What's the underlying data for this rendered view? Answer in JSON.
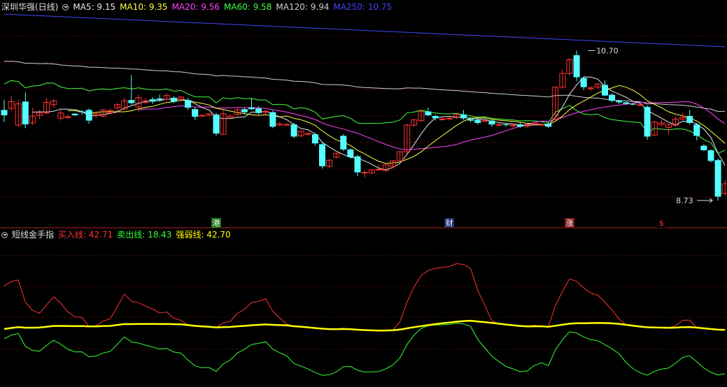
{
  "main_header": {
    "title": "深圳华强(日线)",
    "ma_labels": [
      {
        "text": "MA5: 9.15",
        "color": "#e8e8e8"
      },
      {
        "text": "MA10: 9.35",
        "color": "#ffff44"
      },
      {
        "text": "MA20: 9.56",
        "color": "#ff44ff"
      },
      {
        "text": "MA60: 9.58",
        "color": "#44ff44"
      },
      {
        "text": "MA120: 9.94",
        "color": "#d0d0d0"
      },
      {
        "text": "MA250: 10.75",
        "color": "#4444ff"
      }
    ]
  },
  "sub_header": {
    "title": "短线金手指",
    "labels": [
      {
        "text": "买入线: 42.71",
        "color": "#ff3333"
      },
      {
        "text": "卖出线: 18.43",
        "color": "#33ff33"
      },
      {
        "text": "强弱线: 42.70",
        "color": "#ffff00"
      }
    ]
  },
  "markers": [
    {
      "text": "港",
      "bg": "#1a7a1a",
      "fg": "#ffffff",
      "index": 30
    },
    {
      "text": "财",
      "bg": "#1a2a6a",
      "fg": "#ffffff",
      "index": 63
    },
    {
      "text": "涨",
      "bg": "#7a1a1a",
      "fg": "#ffffff",
      "index": 80
    },
    {
      "text": "$",
      "bg": "#000000",
      "fg": "#ff3333",
      "index": 93
    }
  ],
  "colors": {
    "up": "#ff3333",
    "down": "#54ffff",
    "grid": "#8b1a1a"
  },
  "chart_data": [
    {
      "type": "candlestick",
      "title": "深圳华强(日线)",
      "ylim": [
        8.5,
        11.2
      ],
      "annotations": [
        {
          "text": "10.70",
          "index": 82,
          "price": 10.7
        },
        {
          "text": "8.73",
          "index": 101,
          "price": 8.73
        }
      ],
      "candles": [
        [
          9.92,
          9.85,
          10.05,
          9.76
        ],
        [
          9.94,
          10.03,
          10.1,
          9.9
        ],
        [
          9.72,
          10.0,
          10.05,
          9.7
        ],
        [
          10.03,
          9.73,
          10.15,
          9.68
        ],
        [
          9.75,
          9.84,
          9.95,
          9.72
        ],
        [
          9.85,
          9.88,
          9.92,
          9.8
        ],
        [
          9.88,
          10.02,
          10.08,
          9.86
        ],
        [
          9.99,
          10.04,
          10.06,
          9.95
        ],
        [
          9.81,
          9.88,
          9.92,
          9.78
        ],
        [
          9.82,
          9.83,
          9.86,
          9.8
        ],
        [
          9.87,
          9.85,
          9.88,
          9.84
        ],
        [
          9.9,
          9.89,
          9.92,
          9.86
        ],
        [
          9.92,
          9.78,
          9.94,
          9.74
        ],
        [
          9.85,
          9.87,
          9.89,
          9.82
        ],
        [
          9.84,
          9.92,
          9.93,
          9.82
        ],
        [
          9.88,
          9.91,
          9.94,
          9.86
        ],
        [
          9.95,
          9.99,
          10.01,
          9.9
        ],
        [
          9.93,
          10.04,
          10.08,
          9.91
        ],
        [
          10.05,
          10.01,
          10.38,
          9.99
        ],
        [
          9.96,
          10.08,
          10.12,
          9.9
        ],
        [
          10.02,
          10.04,
          10.08,
          10.0
        ],
        [
          10.06,
          10.03,
          10.09,
          10.0
        ],
        [
          10.07,
          10.05,
          10.12,
          10.03
        ],
        [
          10.06,
          10.11,
          10.14,
          10.04
        ],
        [
          10.08,
          10.03,
          10.1,
          10.01
        ],
        [
          10.06,
          10.09,
          10.1,
          10.03
        ],
        [
          10.05,
          9.95,
          10.08,
          9.92
        ],
        [
          9.93,
          9.83,
          9.96,
          9.79
        ],
        [
          9.84,
          9.85,
          9.86,
          9.83
        ],
        [
          9.85,
          9.87,
          9.88,
          9.84
        ],
        [
          9.86,
          9.61,
          9.88,
          9.58
        ],
        [
          9.6,
          9.87,
          9.92,
          9.59
        ],
        [
          9.82,
          9.84,
          9.86,
          9.8
        ],
        [
          9.86,
          9.92,
          9.95,
          9.84
        ],
        [
          9.93,
          9.89,
          9.95,
          9.86
        ],
        [
          9.95,
          9.93,
          10.08,
          9.92
        ],
        [
          9.94,
          9.88,
          9.97,
          9.86
        ],
        [
          9.89,
          9.9,
          9.92,
          9.86
        ],
        [
          9.89,
          9.7,
          9.91,
          9.68
        ],
        [
          9.72,
          9.74,
          9.76,
          9.71
        ],
        [
          9.73,
          9.73,
          9.74,
          9.72
        ],
        [
          9.73,
          9.57,
          9.75,
          9.55
        ],
        [
          9.58,
          9.64,
          9.65,
          9.56
        ],
        [
          9.6,
          9.61,
          9.62,
          9.58
        ],
        [
          9.6,
          9.48,
          9.62,
          9.45
        ],
        [
          9.47,
          9.18,
          9.5,
          9.15
        ],
        [
          9.18,
          9.26,
          9.27,
          9.16
        ],
        [
          9.3,
          9.35,
          9.36,
          9.28
        ],
        [
          9.58,
          9.4,
          9.6,
          9.38
        ],
        [
          9.4,
          9.3,
          9.42,
          9.28
        ],
        [
          9.31,
          9.1,
          9.33,
          9.05
        ],
        [
          9.1,
          9.1,
          9.12,
          9.03
        ],
        [
          9.09,
          9.13,
          9.14,
          9.08
        ],
        [
          9.14,
          9.14,
          9.2,
          9.12
        ],
        [
          9.12,
          9.2,
          9.22,
          9.11
        ],
        [
          9.18,
          9.25,
          9.26,
          9.16
        ],
        [
          9.25,
          9.37,
          9.38,
          9.23
        ],
        [
          9.37,
          9.72,
          9.74,
          9.35
        ],
        [
          9.72,
          9.79,
          9.8,
          9.7
        ],
        [
          9.78,
          9.9,
          9.92,
          9.76
        ],
        [
          9.9,
          9.85,
          9.95,
          9.84
        ],
        [
          9.84,
          9.81,
          9.86,
          9.78
        ],
        [
          9.8,
          9.8,
          9.82,
          9.78
        ],
        [
          9.81,
          9.81,
          9.83,
          9.79
        ],
        [
          9.82,
          9.86,
          9.88,
          9.8
        ],
        [
          9.86,
          9.81,
          9.92,
          9.79
        ],
        [
          9.8,
          9.78,
          9.82,
          9.76
        ],
        [
          9.79,
          9.75,
          9.81,
          9.73
        ],
        [
          9.78,
          9.78,
          9.8,
          9.76
        ],
        [
          9.78,
          9.73,
          9.8,
          9.7
        ],
        [
          9.72,
          9.73,
          9.74,
          9.71
        ],
        [
          9.73,
          9.72,
          9.75,
          9.7
        ],
        [
          9.72,
          9.72,
          9.74,
          9.69
        ],
        [
          9.73,
          9.7,
          9.75,
          9.68
        ],
        [
          9.7,
          9.73,
          9.74,
          9.69
        ],
        [
          9.73,
          9.74,
          9.75,
          9.72
        ],
        [
          9.72,
          9.73,
          9.74,
          9.71
        ],
        [
          9.74,
          9.7,
          9.76,
          9.68
        ],
        [
          9.79,
          10.22,
          10.23,
          9.78
        ],
        [
          10.22,
          10.4,
          10.45,
          10.2
        ],
        [
          10.4,
          10.58,
          10.6,
          10.37
        ],
        [
          10.64,
          10.35,
          10.7,
          10.3
        ],
        [
          10.34,
          10.22,
          10.36,
          10.18
        ],
        [
          10.21,
          10.21,
          10.23,
          10.17
        ],
        [
          10.22,
          10.26,
          10.27,
          10.2
        ],
        [
          10.25,
          10.11,
          10.31,
          10.1
        ],
        [
          10.12,
          10.04,
          10.14,
          10.02
        ],
        [
          10.04,
          10.02,
          10.05,
          10.0
        ],
        [
          10.02,
          10.0,
          10.03,
          9.99
        ],
        [
          10.0,
          9.99,
          10.01,
          9.98
        ],
        [
          9.98,
          9.99,
          10.0,
          9.97
        ],
        [
          9.96,
          9.57,
          9.98,
          9.53
        ],
        [
          9.59,
          9.76,
          9.78,
          9.58
        ],
        [
          9.73,
          9.75,
          9.8,
          9.7
        ],
        [
          9.69,
          9.73,
          9.74,
          9.6
        ],
        [
          9.72,
          9.8,
          9.83,
          9.7
        ],
        [
          9.8,
          9.82,
          9.88,
          9.79
        ],
        [
          9.84,
          9.75,
          9.92,
          9.73
        ],
        [
          9.73,
          9.58,
          9.75,
          9.52
        ],
        [
          9.45,
          9.39,
          9.47,
          9.38
        ],
        [
          9.39,
          9.25,
          9.4,
          9.23
        ],
        [
          9.26,
          8.78,
          9.28,
          8.73
        ],
        [
          8.82,
          8.95,
          9.0,
          8.8
        ]
      ]
    },
    {
      "type": "line",
      "title": "短线金手指",
      "series": [
        {
          "name": "买入线",
          "color": "#ff3333"
        },
        {
          "name": "卖出线",
          "color": "#33ff33"
        },
        {
          "name": "强弱线",
          "color": "#ffff00"
        }
      ]
    }
  ]
}
